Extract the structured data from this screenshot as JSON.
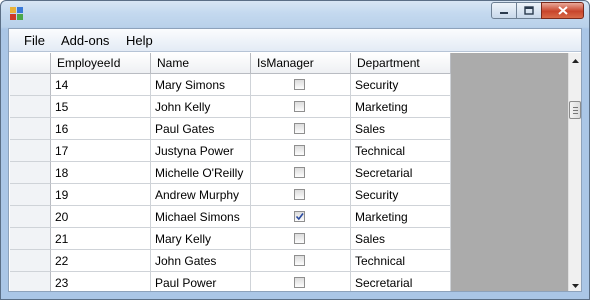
{
  "menu": [
    "File",
    "Add-ons",
    "Help"
  ],
  "grid": {
    "columns": [
      "EmployeeId",
      "Name",
      "IsManager",
      "Department"
    ],
    "rows": [
      {
        "id": "14",
        "name": "Mary Simons",
        "manager": false,
        "dept": "Security"
      },
      {
        "id": "15",
        "name": "John Kelly",
        "manager": false,
        "dept": "Marketing"
      },
      {
        "id": "16",
        "name": "Paul Gates",
        "manager": false,
        "dept": "Sales"
      },
      {
        "id": "17",
        "name": "Justyna Power",
        "manager": false,
        "dept": "Technical"
      },
      {
        "id": "18",
        "name": "Michelle O'Reilly",
        "manager": false,
        "dept": "Secretarial"
      },
      {
        "id": "19",
        "name": "Andrew Murphy",
        "manager": false,
        "dept": "Security"
      },
      {
        "id": "20",
        "name": "Michael Simons",
        "manager": true,
        "dept": "Marketing"
      },
      {
        "id": "21",
        "name": "Mary Kelly",
        "manager": false,
        "dept": "Sales"
      },
      {
        "id": "22",
        "name": "John Gates",
        "manager": false,
        "dept": "Technical"
      },
      {
        "id": "23",
        "name": "Paul Power",
        "manager": false,
        "dept": "Secretarial"
      }
    ]
  },
  "icons": {
    "app": "app-icon",
    "minimize": "minimize-icon",
    "maximize": "maximize-icon",
    "close": "close-icon",
    "check": "checkmark-icon",
    "scroll_up": "arrow-up-icon",
    "scroll_down": "arrow-down-icon"
  },
  "colors": {
    "title_bar": "#b9d1ea",
    "close_button": "#c8452c",
    "grid_background": "#ababab",
    "check": "#2a4aa0"
  }
}
